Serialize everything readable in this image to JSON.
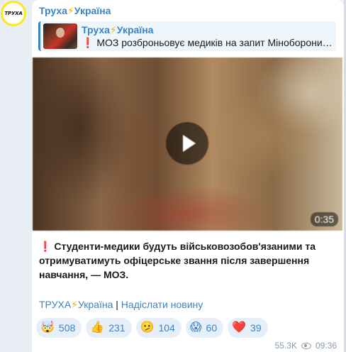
{
  "channel": {
    "avatar_text": "ТРУХА",
    "name": "Труха",
    "name_suffix": "Україна",
    "bolt": "⚡"
  },
  "reply": {
    "title": "Труха",
    "title_suffix": "Україна",
    "bolt": "⚡",
    "mark": "❗",
    "text": "МОЗ розброньовує медиків на запит Міноборони. ..."
  },
  "video": {
    "duration": "0:35"
  },
  "message": {
    "mark": "❗",
    "text": "Студенти-медики будуть військовозобов'язаними та отримуватимуть офіцерське звання після завершення навчання, — МОЗ."
  },
  "footer": {
    "link1": "ТРУХА",
    "link1_suffix": "Україна",
    "bolt": "⚡",
    "separator": " | ",
    "link2": "Надіслати новину"
  },
  "reactions": [
    {
      "emoji": "🤯",
      "count": "508"
    },
    {
      "emoji": "👍",
      "count": "231"
    },
    {
      "emoji": "🫤",
      "count": "104"
    },
    {
      "emoji": "😱",
      "count": "60"
    },
    {
      "emoji": "❤️",
      "count": "39"
    }
  ],
  "meta": {
    "views": "55.3K",
    "time": "09:36"
  },
  "colors": {
    "accent": "#3a84c4",
    "avatar_bg": "#ffe81a"
  }
}
